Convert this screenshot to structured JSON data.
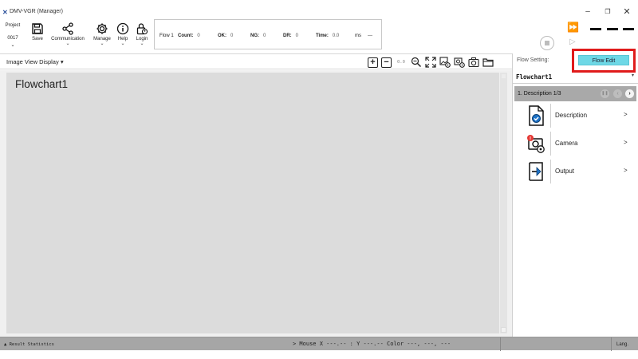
{
  "window": {
    "title": "DMV-VGR (Manager)",
    "minimize": "–",
    "maximize": "❐",
    "close": "✕"
  },
  "toolbar": {
    "project_label": "Project",
    "project_number": "0017",
    "save": "Save",
    "communication": "Communication",
    "manage": "Manage",
    "help": "Help",
    "login": "Login"
  },
  "stats": {
    "flow": "Flow 1",
    "count_label": "Count:",
    "count_value": "0",
    "ok_label": "OK:",
    "ok_value": "0",
    "ng_label": "NG:",
    "ng_value": "0",
    "dr_label": "DR:",
    "dr_value": "0",
    "time_label": "Time:",
    "time_value": "0.0",
    "time_unit": "ms",
    "extra": "---"
  },
  "image_view": {
    "title": "Image View Display",
    "zoom": "0.0",
    "canvas_title": "Flowchart1"
  },
  "right_panel": {
    "flow_setting_label": "Flow Setting:",
    "flow_edit_button": "Flow Edit",
    "flowchart_name": "Flowchart1",
    "description_header": "1. Description 1/3",
    "items": [
      {
        "label": "Description",
        "arrow": ">"
      },
      {
        "label": "Camera",
        "arrow": ">"
      },
      {
        "label": "Output",
        "arrow": ">"
      }
    ]
  },
  "status_bar": {
    "result_statistics": "Result Statistics",
    "mouse_info": "> Mouse X ---.-- : Y ---.-- Color ---, ---, ---",
    "lang": "Lang."
  },
  "colors": {
    "flow_edit_bg": "#6ed8e6",
    "highlight_red": "#e01b1b",
    "status_bar": "#a6a6a6",
    "canvas": "#dcdcdc"
  }
}
